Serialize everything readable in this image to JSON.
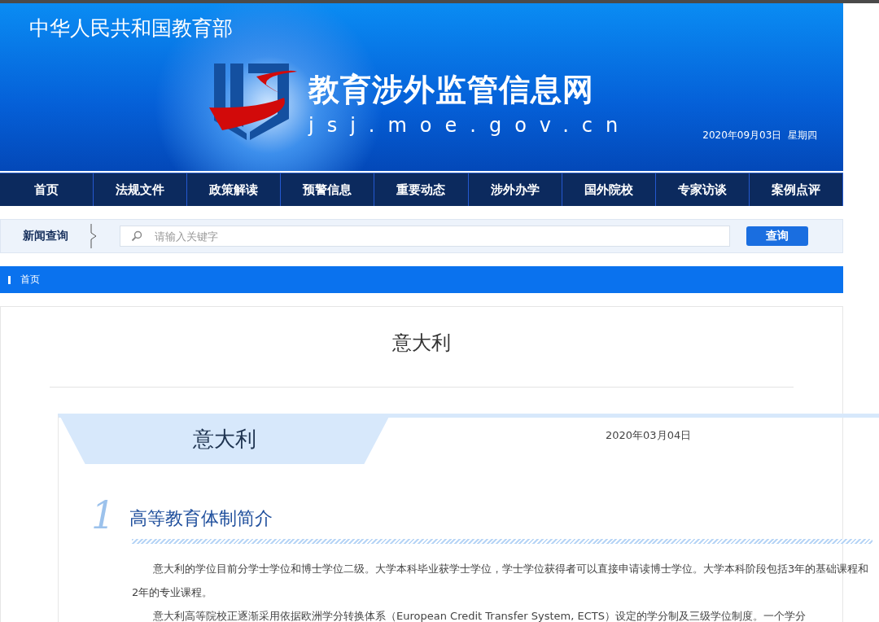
{
  "banner": {
    "ministry": "中华人民共和国教育部",
    "site_title": "教育涉外监管信息网",
    "site_url": "jsj.moe.gov.cn",
    "date": "2020年09月03日  星期四"
  },
  "nav": [
    "首页",
    "法规文件",
    "政策解读",
    "预警信息",
    "重要动态",
    "涉外办学",
    "国外院校",
    "专家访谈",
    "案例点评"
  ],
  "search": {
    "label": "新闻查询",
    "placeholder": "请输入关键字",
    "button": "查询"
  },
  "breadcrumb": "首页",
  "page_title": "意大利",
  "article": {
    "title": "意大利",
    "date": "2020年03月04日",
    "section": {
      "number": "1",
      "heading": "高等教育体制简介",
      "paragraphs": [
        "意大利的学位目前分学士学位和博士学位二级。大学本科毕业获学士学位，学士学位获得者可以直接申请读博士学位。大学本科阶段包括3年的基础课程和2年的专业课程。",
        "意大利高等院校正逐渐采用依据欧洲学分转换体系（European Credit Transfer System, ECTS）设定的学分制及三级学位制度。一个学分"
      ]
    }
  }
}
